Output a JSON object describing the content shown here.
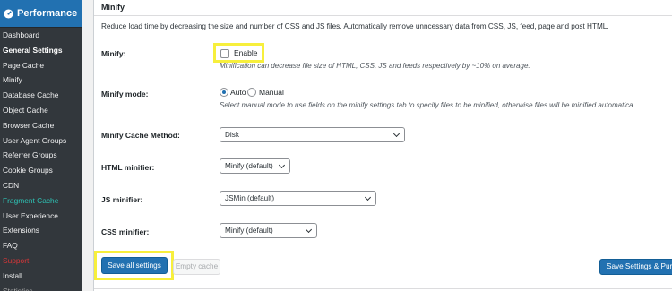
{
  "sidebar": {
    "menu_title": "Performance",
    "items": [
      {
        "label": "Dashboard"
      },
      {
        "label": "General Settings"
      },
      {
        "label": "Page Cache"
      },
      {
        "label": "Minify"
      },
      {
        "label": "Database Cache"
      },
      {
        "label": "Object Cache"
      },
      {
        "label": "Browser Cache"
      },
      {
        "label": "User Agent Groups"
      },
      {
        "label": "Referrer Groups"
      },
      {
        "label": "Cookie Groups"
      },
      {
        "label": "CDN"
      },
      {
        "label": "Fragment Cache"
      },
      {
        "label": "User Experience"
      },
      {
        "label": "Extensions"
      },
      {
        "label": "FAQ"
      },
      {
        "label": "Support"
      },
      {
        "label": "Install"
      },
      {
        "label": "Statistics"
      }
    ]
  },
  "section": {
    "title": "Minify",
    "intro": "Reduce load time by decreasing the size and number of CSS and JS files. Automatically remove unncessary data from CSS, JS, feed, page and post HTML."
  },
  "minify": {
    "label": "Minify:",
    "checkbox_label": "Enable",
    "checked": false,
    "help": "Minification can decrease file size of HTML, CSS, JS and feeds respectively by ~10% on average."
  },
  "mode": {
    "label": "Minify mode:",
    "options": [
      "Auto",
      "Manual"
    ],
    "selected": "Auto",
    "help": "Select manual mode to use fields on the minify settings tab to specify files to be minified, otherwise files will be minified automatica"
  },
  "cache_method": {
    "label": "Minify Cache Method:",
    "value": "Disk"
  },
  "html_minifier": {
    "label": "HTML minifier:",
    "value": "Minify (default)"
  },
  "js_minifier": {
    "label": "JS minifier:",
    "value": "JSMin (default)"
  },
  "css_minifier": {
    "label": "CSS minifier:",
    "value": "Minify (default)"
  },
  "buttons": {
    "save_all": "Save all settings",
    "empty_cache": "Empty cache",
    "save_purge": "Save Settings & Purg"
  },
  "colors": {
    "sidebar_bg": "#23282d",
    "accent": "#2271b1",
    "highlight": "#f7ef3c",
    "fragment_cache": "#2ec4b6",
    "support": "#d63638"
  }
}
